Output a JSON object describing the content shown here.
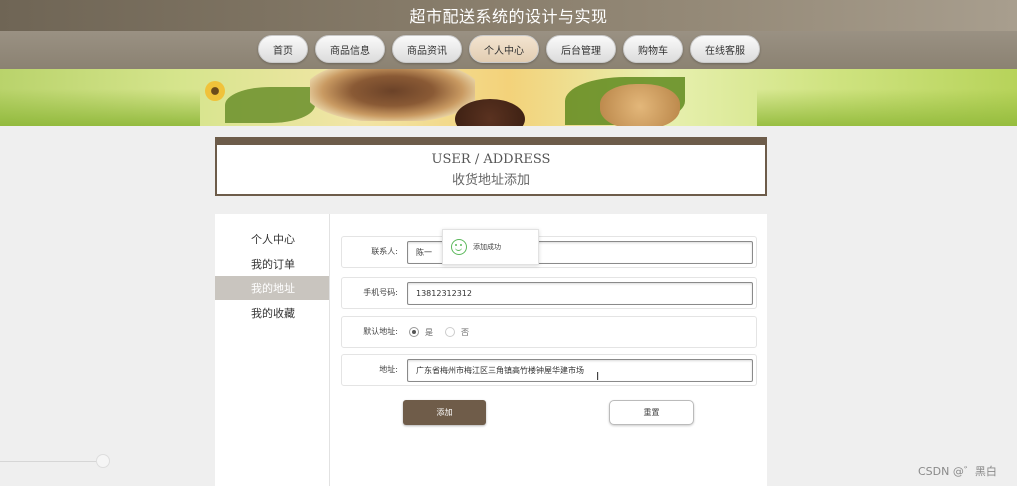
{
  "site": {
    "title": "超市配送系统的设计与实现"
  },
  "nav": {
    "items": [
      {
        "label": "首页",
        "active": false
      },
      {
        "label": "商品信息",
        "active": false
      },
      {
        "label": "商品资讯",
        "active": false
      },
      {
        "label": "个人中心",
        "active": true
      },
      {
        "label": "后台管理",
        "active": false
      },
      {
        "label": "购物车",
        "active": false
      },
      {
        "label": "在线客服",
        "active": false
      }
    ]
  },
  "page_header": {
    "title_en": "USER / ADDRESS",
    "title_cn": "收货地址添加"
  },
  "sidebar": {
    "items": [
      {
        "label": "个人中心",
        "active": false
      },
      {
        "label": "我的订单",
        "active": false
      },
      {
        "label": "我的地址",
        "active": true
      },
      {
        "label": "我的收藏",
        "active": false
      }
    ]
  },
  "form": {
    "contact": {
      "label": "联系人:",
      "value": "陈一"
    },
    "phone": {
      "label": "手机号码:",
      "value": "13812312312"
    },
    "default_address": {
      "label": "默认地址:",
      "options": [
        "是",
        "否"
      ],
      "selected": "是"
    },
    "address": {
      "label": "地址:",
      "value": "广东省梅州市梅江区三角镇高竹楼钟屋华建市场"
    },
    "add_button": "添加",
    "reset_button": "重置"
  },
  "toast": {
    "message": "添加成功",
    "icon": "smile-icon"
  },
  "watermark": "CSDN @゛黑白",
  "colors": {
    "accent": "#6f5c49",
    "sidebar_active": "#c9c5bf",
    "toast_icon": "#5cb85c"
  }
}
